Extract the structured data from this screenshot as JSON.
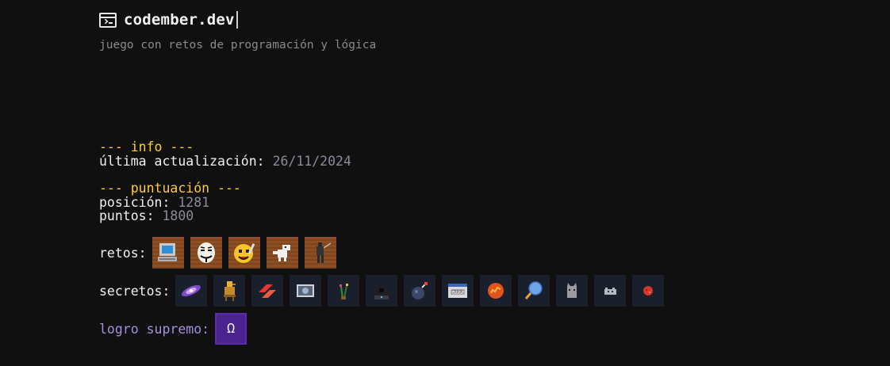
{
  "header": {
    "title": "codember.dev",
    "subtitle": "juego con retos de programación y lógica"
  },
  "info": {
    "heading": "--- info ---",
    "updated_label": "última actualización:",
    "updated_value": "26/11/2024"
  },
  "score": {
    "heading": "--- puntuación ---",
    "position_label": "posición:",
    "position_value": "1281",
    "points_label": "puntos:",
    "points_value": "1800"
  },
  "retos": {
    "label": "retos:",
    "items": [
      "computer-badge-icon",
      "mask-badge-icon",
      "emoji-badge-icon",
      "dino-badge-icon",
      "figure-badge-icon"
    ]
  },
  "secretos": {
    "label": "secretos:",
    "items": [
      "galaxy-icon",
      "duck-icon",
      "chevron-icon",
      "photo-icon",
      "plant-icon",
      "hacker-icon",
      "bomb-icon",
      "error-window-icon",
      "orange-ball-icon",
      "racket-icon",
      "cat-icon",
      "cloud-cat-icon",
      "red-planet-icon"
    ]
  },
  "logro": {
    "label": "logro supremo:",
    "symbol": "Ω"
  },
  "colors": {
    "background": "#101010",
    "heading": "#ffcc33",
    "value": "#8b8b9c",
    "purple": "#a58fe0",
    "reto_bg": "#8c4e22",
    "secreto_bg": "#1a1f2c",
    "omega_bg": "#4a238f"
  }
}
